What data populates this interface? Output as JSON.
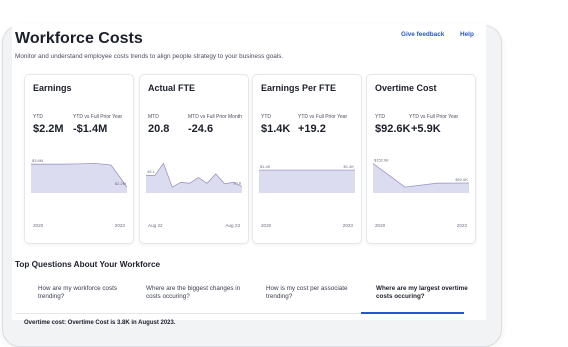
{
  "header": {
    "title": "Workforce Costs",
    "subtitle": "Monitor and understand employee costs trends to align people strategy to your business goals.",
    "links": [
      "Give feedback",
      "Help"
    ]
  },
  "cards": [
    {
      "title": "Earnings",
      "metrics": [
        {
          "label": "YTD",
          "value": "$2.2M"
        },
        {
          "label": "YTD vs Full Prior Year",
          "value": "-$1.4M"
        }
      ],
      "chart": {
        "start_label": "$3.6M",
        "end_label": "$2.2M",
        "x_start": "2020",
        "x_end": "2023",
        "values": [
          3.6,
          3.6,
          3.6,
          3.62,
          3.65,
          3.55,
          2.2
        ]
      }
    },
    {
      "title": "Actual FTE",
      "metrics": [
        {
          "label": "MTD",
          "value": "20.8"
        },
        {
          "label": "MTD vs Full Prior Month",
          "value": "-24.6"
        }
      ],
      "chart": {
        "start_label": "45.1",
        "end_label": "20.8",
        "x_start": "Aug 22",
        "x_end": "Aug 23",
        "values": [
          45.1,
          44,
          70,
          20,
          30,
          28,
          40,
          28,
          48,
          27,
          30,
          20.8
        ]
      }
    },
    {
      "title": "Earnings Per FTE",
      "metrics": [
        {
          "label": "YTD",
          "value": "$1.4K"
        },
        {
          "label": "YTD vs Full Prior Year",
          "value": "+19.2"
        }
      ],
      "chart": {
        "start_label": "$1.4K",
        "end_label": "$1.4K",
        "x_start": "2020",
        "x_end": "2023",
        "values": [
          1.4,
          1.4,
          1.4,
          1.4
        ]
      }
    },
    {
      "title": "Overtime Cost",
      "metrics": [
        {
          "label": "YTD",
          "value": "$92.6K"
        },
        {
          "label": "YTD vs Full Prior Year",
          "value": "+5.9K"
        }
      ],
      "chart": {
        "start_label": "$152.9K",
        "end_label": "$92.6K",
        "x_start": "2020",
        "x_end": "2023",
        "values": [
          152.9,
          80,
          92,
          92.6
        ]
      }
    }
  ],
  "questions": {
    "title": "Top Questions About Your Workforce",
    "tabs": [
      "How are my workforce costs trending?",
      "Where are the biggest changes in costs occuring?",
      "How is my cost per associate trending?",
      "Where are my largest overtime costs occuring?"
    ],
    "active_index": 3,
    "answer": "Overtime cost: Overtime Cost is 3.8K in August 2023."
  },
  "colors": {
    "accent": "#2657c8",
    "chart_fill": "#dcdcf1",
    "chart_line": "#9a96c6"
  }
}
